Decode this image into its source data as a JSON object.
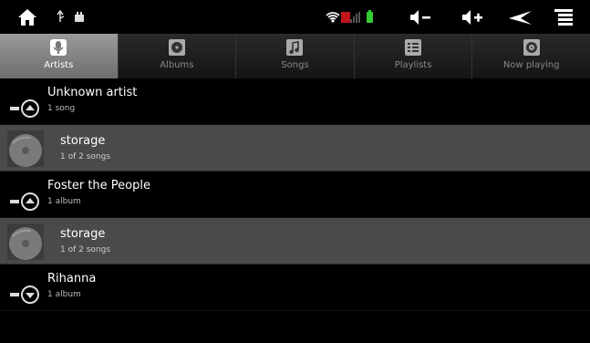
{
  "status": {
    "icons": [
      "home-icon",
      "usb-icon",
      "wifi-icon",
      "signal-icon",
      "battery-icon",
      "volume-down-icon",
      "volume-up-icon",
      "back-icon",
      "menu-icon"
    ]
  },
  "tabs": [
    {
      "label": "Artists",
      "icon": "microphone-icon",
      "active": true
    },
    {
      "label": "Albums",
      "icon": "album-icon",
      "active": false
    },
    {
      "label": "Songs",
      "icon": "music-note-icon",
      "active": false
    },
    {
      "label": "Playlists",
      "icon": "playlist-icon",
      "active": false
    },
    {
      "label": "Now playing",
      "icon": "now-playing-icon",
      "active": false
    }
  ],
  "list": [
    {
      "title": "Unknown artist",
      "sub": "1 song",
      "expanded": true
    },
    {
      "title": "storage",
      "sub": "1 of 2 songs"
    },
    {
      "title": "Foster the People",
      "sub": "1 album",
      "expanded": true
    },
    {
      "title": "storage",
      "sub": "1 of 2 songs"
    },
    {
      "title": "Rihanna",
      "sub": "1 album",
      "expanded": false
    }
  ],
  "colors": {
    "active_tab": "#8a8a8a",
    "child_row": "#4a4a4a",
    "battery": "#33cc33"
  }
}
